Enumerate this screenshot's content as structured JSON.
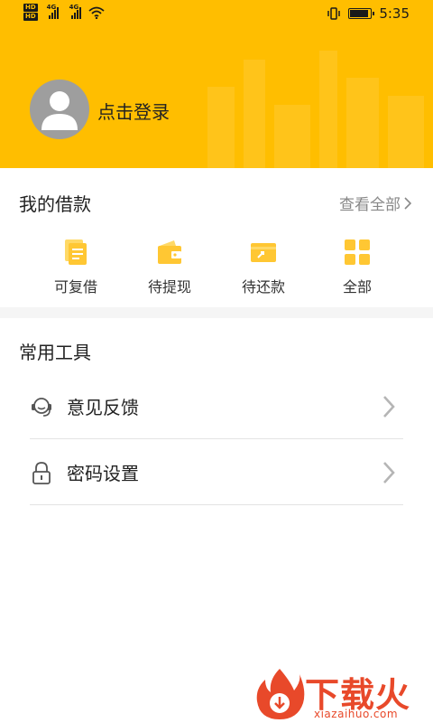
{
  "status_bar": {
    "hd1": "HD",
    "hd2": "HD",
    "net1": "4G",
    "net2": "4G",
    "battery_level": 0.9,
    "time": "5:35"
  },
  "profile": {
    "login_label": "点击登录"
  },
  "loans": {
    "title": "我的借款",
    "view_all": "查看全部",
    "items": [
      {
        "label": "可复借",
        "icon": "document-icon"
      },
      {
        "label": "待提现",
        "icon": "wallet-icon"
      },
      {
        "label": "待还款",
        "icon": "card-icon"
      },
      {
        "label": "全部",
        "icon": "grid-icon"
      }
    ]
  },
  "tools": {
    "title": "常用工具",
    "items": [
      {
        "label": "意见反馈",
        "icon": "headset-icon"
      },
      {
        "label": "密码设置",
        "icon": "lock-icon"
      }
    ]
  },
  "watermark": {
    "brand_cn": "下载火",
    "brand_en": "xiazaihuo.com"
  },
  "colors": {
    "accent": "#FFBE00",
    "icon_yellow": "#FFC733",
    "watermark": "#E8492A"
  }
}
